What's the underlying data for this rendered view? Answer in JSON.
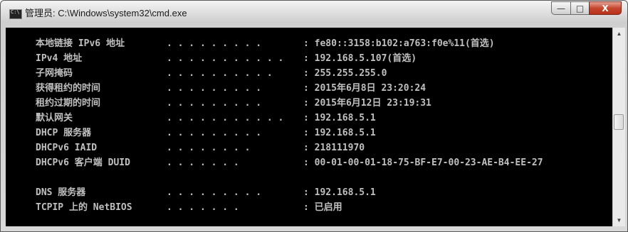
{
  "window": {
    "title": "管理员: C:\\Windows\\system32\\cmd.exe",
    "buttons": {
      "minimize": "—",
      "maximize": "□",
      "close": "X"
    }
  },
  "console": {
    "lines": [
      {
        "key": "本地链接 IPv6 地址",
        "dots": ". . . . . . . . .",
        "value": ": fe80::3158:b102:a763:f0e%11(首选)"
      },
      {
        "key": "IPv4 地址",
        "dots": ". . . . . . . . . . .",
        "value": ": 192.168.5.107(首选)"
      },
      {
        "key": "子网掩码",
        "dots": ". . . . . . . . . .",
        "value": ": 255.255.255.0"
      },
      {
        "key": "获得租约的时间",
        "dots": ". . . . . . . . .",
        "value": ": 2015年6月8日 23:20:24"
      },
      {
        "key": "租约过期的时间",
        "dots": ". . . . . . . . .",
        "value": ": 2015年6月12日 23:19:31"
      },
      {
        "key": "默认网关",
        "dots": ". . . . . . . . . . .",
        "value": ": 192.168.5.1"
      },
      {
        "key": "DHCP 服务器",
        "dots": ". . . . . . . . .",
        "value": ": 192.168.5.1"
      },
      {
        "key": "DHCPv6 IAID",
        "dots": ". . . . . . . .",
        "value": ": 218111970"
      },
      {
        "key": "DHCPv6 客户端 DUID",
        "dots": ". . . . . . .",
        "value": ": 00-01-00-01-18-75-BF-E7-00-23-AE-B4-EE-27"
      },
      {
        "key": "",
        "dots": "",
        "value": ""
      },
      {
        "key": "DNS 服务器",
        "dots": ". . . . . . . . .",
        "value": ": 192.168.5.1"
      },
      {
        "key": "TCPIP 上的 NetBIOS",
        "dots": ". . . . . . .",
        "value": ": 已启用"
      }
    ]
  },
  "scrollbar": {
    "up_icon": "▲",
    "down_icon": "▼"
  }
}
